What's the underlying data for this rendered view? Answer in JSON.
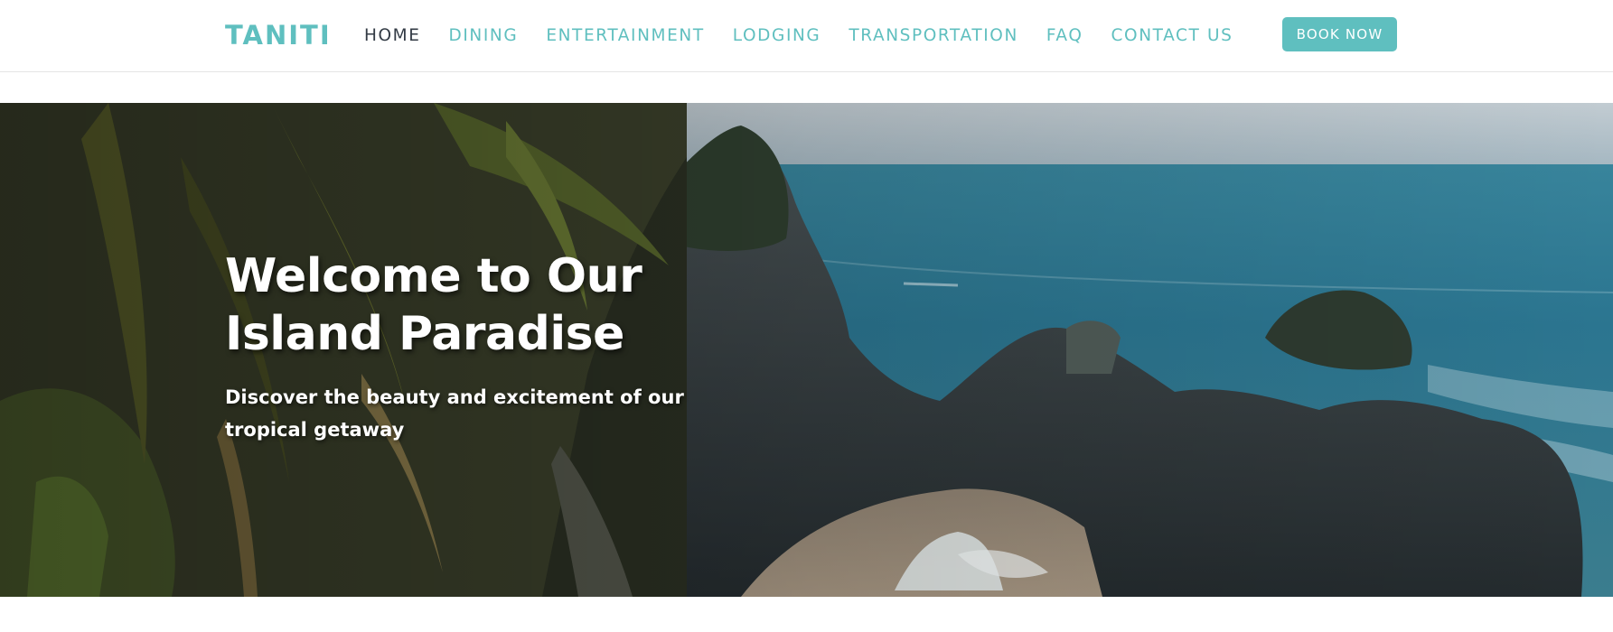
{
  "brand": {
    "name": "TANITI",
    "color": "#5fbfbf"
  },
  "nav": {
    "items": [
      {
        "label": "HOME",
        "active": true
      },
      {
        "label": "DINING",
        "active": false
      },
      {
        "label": "ENTERTAINMENT",
        "active": false
      },
      {
        "label": "LODGING",
        "active": false
      },
      {
        "label": "TRANSPORTATION",
        "active": false
      },
      {
        "label": "FAQ",
        "active": false
      },
      {
        "label": "CONTACT US",
        "active": false
      }
    ],
    "book_label": "BOOK NOW"
  },
  "hero": {
    "title": "Welcome to Our Island Paradise",
    "subtitle": "Discover the beauty and excitement of our tropical getaway",
    "image_description_icon": "coastal-landscape-photo"
  },
  "colors": {
    "accent": "#5fbfbf",
    "active_nav": "#333b45",
    "navbar_bg": "#ffffff",
    "hero_text": "#ffffff"
  }
}
